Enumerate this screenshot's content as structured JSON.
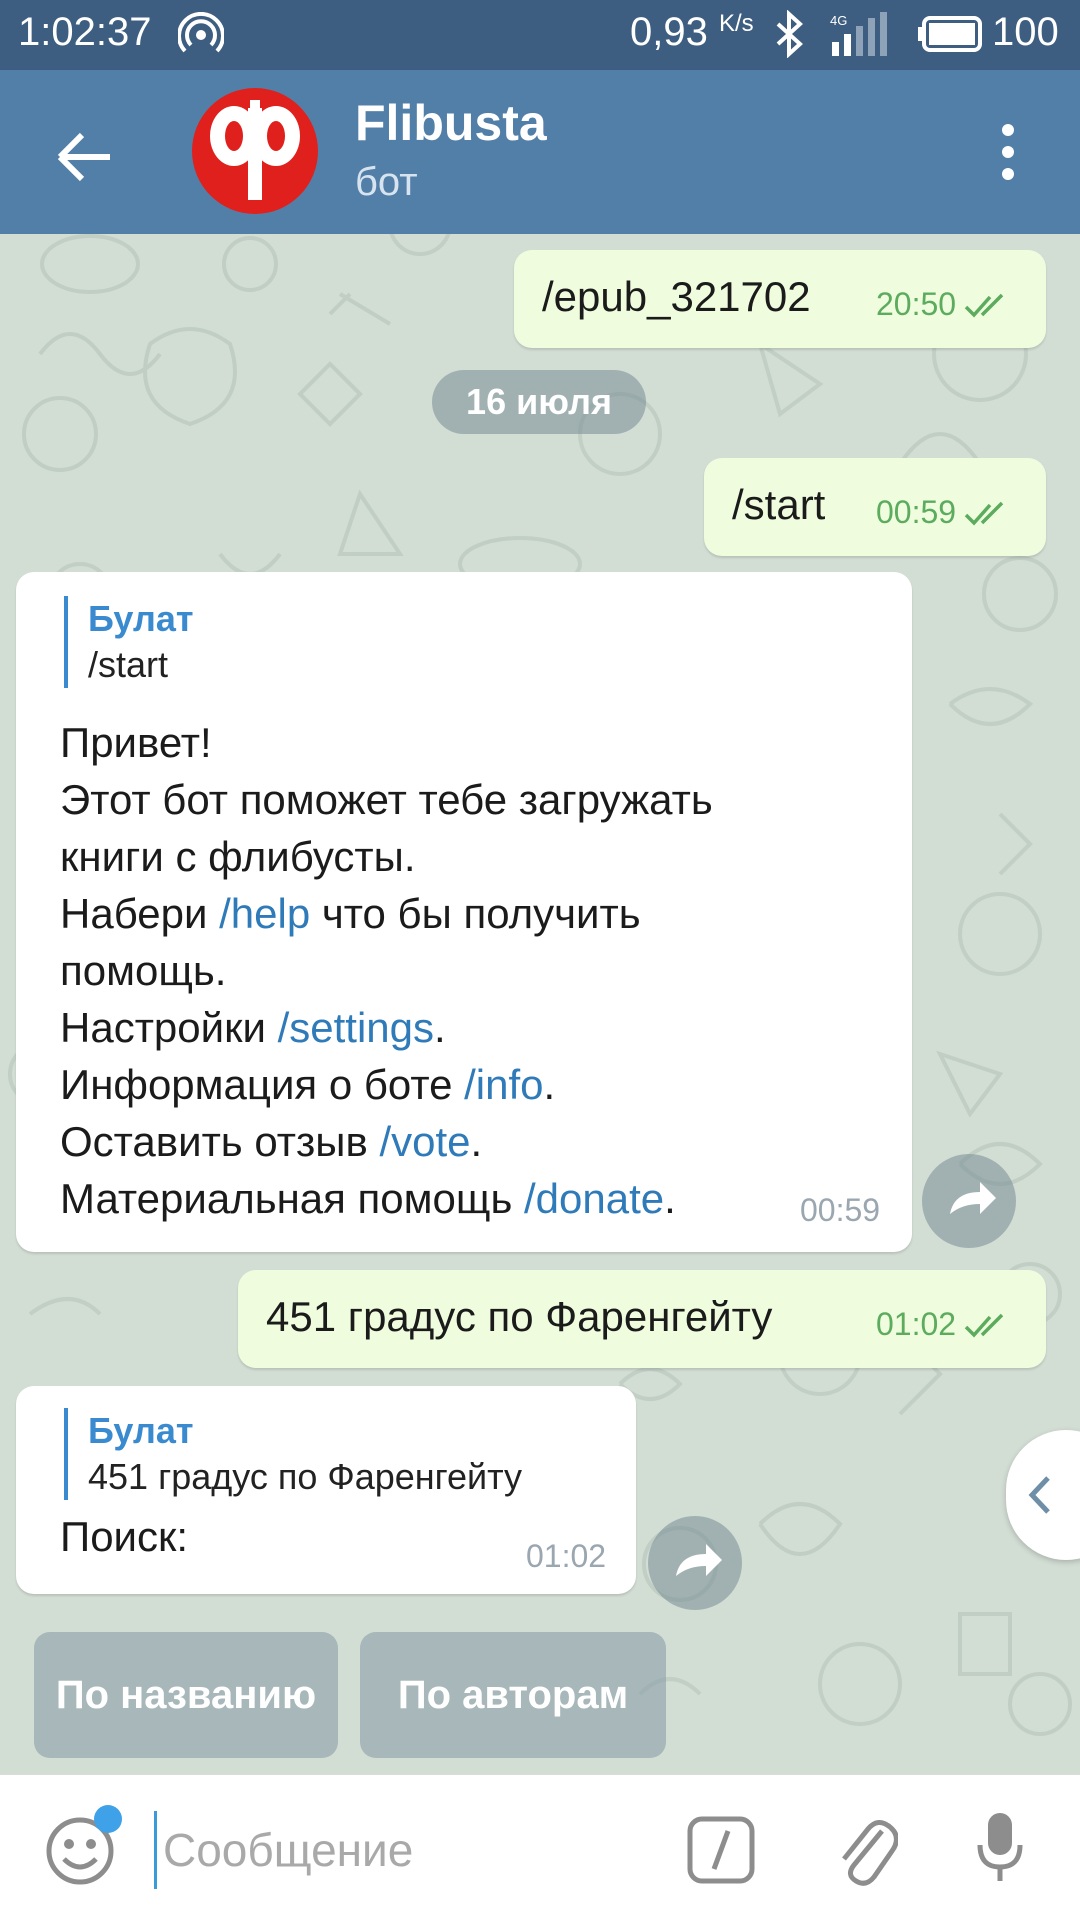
{
  "status_bar": {
    "time": "1:02:37",
    "speed": "0,93",
    "speed_unit": "K/s",
    "battery": "100",
    "network": "4G"
  },
  "header": {
    "title": "Flibusta",
    "subtitle": "бот"
  },
  "messages": {
    "m1": {
      "text": "/epub_321702",
      "time": "20:50"
    },
    "date_divider": "16 июля",
    "m2": {
      "text": "/start",
      "time": "00:59"
    },
    "m3": {
      "reply_name": "Булат",
      "reply_text": "/start",
      "lines": {
        "l1": "Привет!",
        "l2": "Этот бот поможет тебе загружать",
        "l3": "книги с флибусты.",
        "l4a": "Набери ",
        "l4cmd": "/help",
        "l4b": " что бы получить",
        "l5": "помощь.",
        "l6a": "Настройки ",
        "l6cmd": "/settings",
        "l7a": "Информация о боте ",
        "l7cmd": "/info",
        "l8a": "Оставить отзыв ",
        "l8cmd": "/vote",
        "l9a": "Материальная помощь ",
        "l9cmd": "/donate",
        "dot": "."
      },
      "time": "00:59"
    },
    "m4": {
      "text": "451 градус по Фаренгейту",
      "time": "01:02"
    },
    "m5": {
      "reply_name": "Булат",
      "reply_text": "451 градус по Фаренгейту",
      "text": "Поиск:",
      "time": "01:02"
    }
  },
  "keyboard": {
    "by_title": "По названию",
    "by_author": "По авторам"
  },
  "input": {
    "placeholder": "Сообщение"
  },
  "colors": {
    "status_bar": "#3d5e80",
    "app_bar": "#527fa8",
    "outgoing_bubble": "#effdde",
    "incoming_bubble": "#ffffff",
    "link": "#2f7ab8",
    "check_marks": "#5cab5e"
  },
  "icons": {
    "back": "arrow-left-icon",
    "menu": "more-vert-icon",
    "share": "share-icon",
    "emoji": "smile-icon",
    "command": "slash-command-icon",
    "attach": "paperclip-icon",
    "mic": "microphone-icon"
  }
}
